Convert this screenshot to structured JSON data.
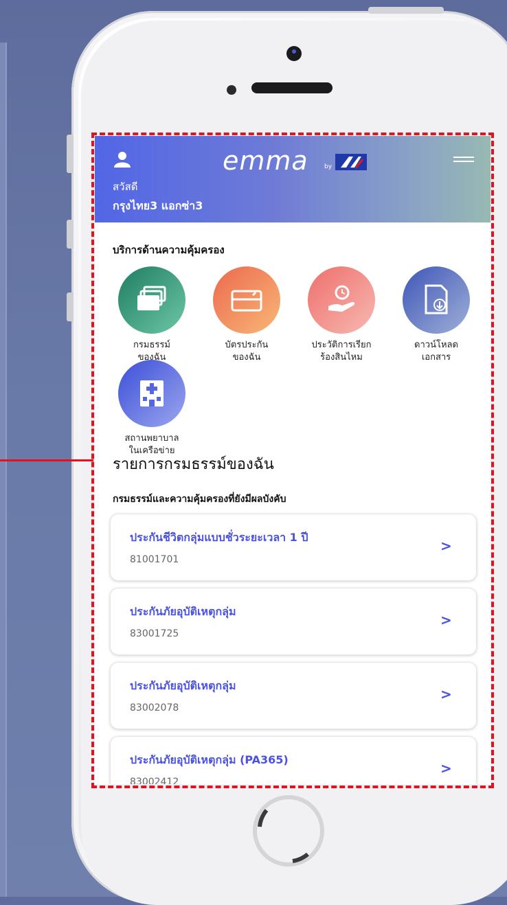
{
  "header": {
    "logo": "emma",
    "logo_by": "by",
    "greeting": "สวัสดี",
    "user_name": "กรุงไทย3 แอกซ่า3"
  },
  "services": {
    "title": "บริการด้านความคุ้มครอง",
    "items": [
      {
        "line1": "กรมธรรม์",
        "line2": "ของฉัน",
        "icon": "policy-cards-icon",
        "color": "#2e9a7a"
      },
      {
        "line1": "บัตรประกัน",
        "line2": "ของฉัน",
        "icon": "insurance-card-icon",
        "color": "#f08a5d"
      },
      {
        "line1": "ประวัติการเรียก",
        "line2": "ร้องสินไหม",
        "icon": "claim-history-icon",
        "color": "#f17d7d"
      },
      {
        "line1": "ดาวน์โหลด",
        "line2": "เอกสาร",
        "icon": "download-document-icon",
        "color": "#5a6fc4"
      },
      {
        "line1": "สถานพยาบาล",
        "line2": "ในเครือข่าย",
        "icon": "hospital-icon",
        "color": "#5566e0"
      }
    ]
  },
  "policies": {
    "title": "รายการกรมธรรม์ของฉัน",
    "subtitle": "กรมธรรม์และความคุ้มครองที่ยังมีผลบังคับ",
    "items": [
      {
        "name": "ประกันชีวิตกลุ่มแบบชั่วระยะเวลา 1 ปี",
        "number": "81001701"
      },
      {
        "name": "ประกันภัยอุบัติเหตุกลุ่ม",
        "number": "83001725"
      },
      {
        "name": "ประกันภัยอุบัติเหตุกลุ่ม",
        "number": "83002078"
      },
      {
        "name": "ประกันภัยอุบัติเหตุกลุ่ม (PA365)",
        "number": "83002412"
      }
    ],
    "chevron": ">"
  },
  "colors": {
    "accent": "#4a53e0",
    "highlight": "#e0141e"
  }
}
